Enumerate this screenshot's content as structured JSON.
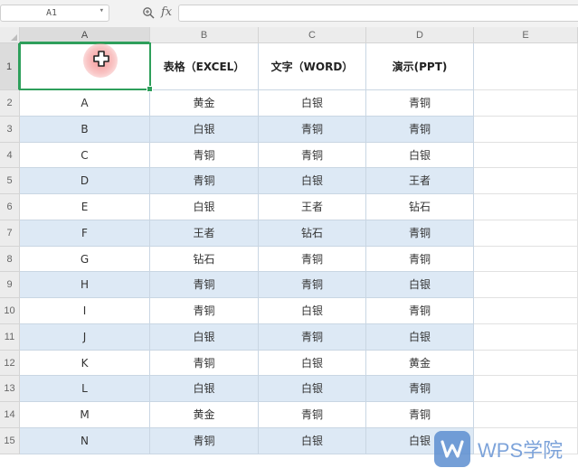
{
  "formula_bar": {
    "name_box": "A1",
    "name_box_dropdown_icon": "chevron-down-icon",
    "zoom_icon": "magnifier-icon",
    "fx_label": "fx",
    "formula_value": ""
  },
  "columns": [
    "A",
    "B",
    "C",
    "D",
    "E"
  ],
  "rows": [
    "1",
    "2",
    "3",
    "4",
    "5",
    "6",
    "7",
    "8",
    "9",
    "10",
    "11",
    "12",
    "13",
    "14",
    "15"
  ],
  "table": {
    "header": [
      "",
      "表格（EXCEL）",
      "文字（WORD）",
      "演示(PPT)"
    ],
    "body": [
      [
        "A",
        "黄金",
        "白银",
        "青铜"
      ],
      [
        "B",
        "白银",
        "青铜",
        "青铜"
      ],
      [
        "C",
        "青铜",
        "青铜",
        "白银"
      ],
      [
        "D",
        "青铜",
        "白银",
        "王者"
      ],
      [
        "E",
        "白银",
        "王者",
        "钻石"
      ],
      [
        "F",
        "王者",
        "钻石",
        "青铜"
      ],
      [
        "G",
        "钻石",
        "青铜",
        "青铜"
      ],
      [
        "H",
        "青铜",
        "青铜",
        "白银"
      ],
      [
        "I",
        "青铜",
        "白银",
        "青铜"
      ],
      [
        "J",
        "白银",
        "青铜",
        "白银"
      ],
      [
        "K",
        "青铜",
        "白银",
        "黄金"
      ],
      [
        "L",
        "白银",
        "白银",
        "青铜"
      ],
      [
        "M",
        "黄金",
        "青铜",
        "青铜"
      ],
      [
        "N",
        "青铜",
        "白银",
        "白银"
      ]
    ]
  },
  "selection": {
    "active_cell": "A1",
    "cursor_icon": "cell-select-cross-icon"
  },
  "colors": {
    "band": "#dde9f5",
    "selection": "#2e9f5b",
    "grid": "#c9d6e3"
  },
  "watermark": {
    "text": "WPS学院",
    "logo_icon": "wps-logo-icon"
  }
}
